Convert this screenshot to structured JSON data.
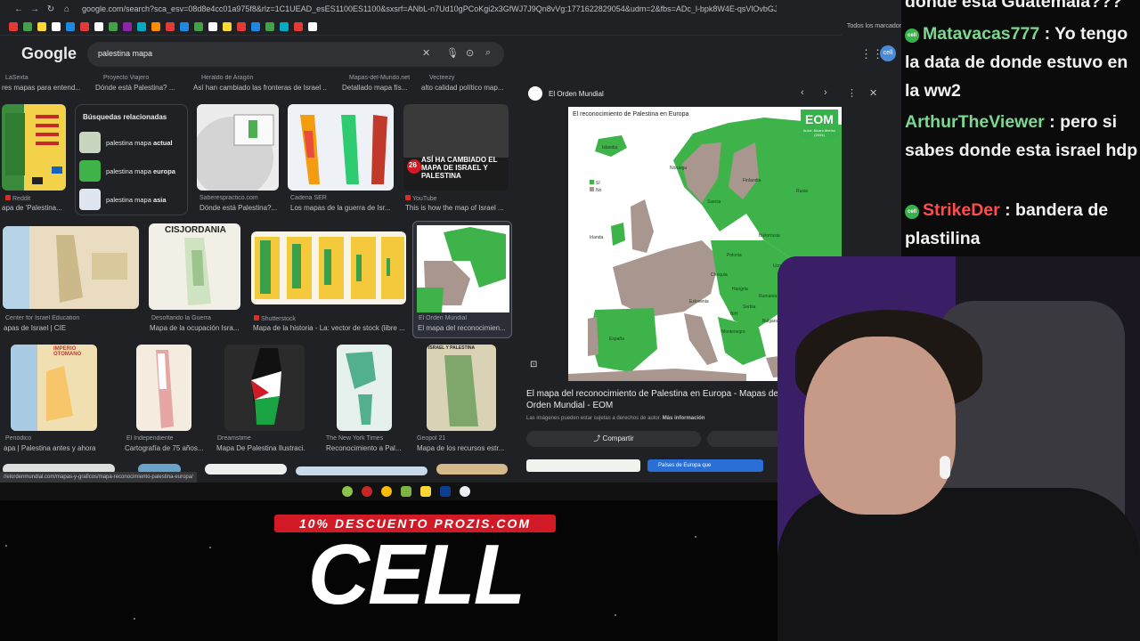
{
  "browser": {
    "url": "google.com/search?sca_esv=08d8e4cc01a975f8&rlz=1C1UEAD_esES1100ES1100&sxsrf=ANbL-n7Ud10gPCoKgi2x3GfWJ7J9Qn8vVg:1771622829054&udm=2&fbs=ADc_l-bpk8W4E-qsVlOvbGJcDwpn60DczFdcvPnuv8WQchHL",
    "bookmarks_all": "Todos los marcador",
    "status_url": "//elordenmundial.com/mapas-y-graficos/mapa-reconocimiento-palestina-europa/"
  },
  "google": {
    "logo": "Google",
    "query": "palestina mapa"
  },
  "row0_meta": [
    {
      "source": "LaSexta",
      "title": "res mapas para entend..."
    },
    {
      "source": "Proyecto Viajero",
      "title": "Dónde está Palestina? ..."
    },
    {
      "source": "Heraldo de Aragón",
      "title": "Así han cambiado las fronteras de Israel ..."
    },
    {
      "source": "Mapas-del-Mundo.net",
      "title": "Detallado mapa fís..."
    },
    {
      "source": "Vecteezy",
      "title": "alto calidad político map..."
    }
  ],
  "related": {
    "title": "Búsquedas relacionadas",
    "items": [
      {
        "prefix": "palestina mapa ",
        "bold": "actual"
      },
      {
        "prefix": "palestina mapa ",
        "bold": "europa"
      },
      {
        "prefix": "palestina mapa ",
        "bold": "asia"
      }
    ]
  },
  "row1": [
    {
      "source": "Reddit",
      "title": "apa de 'Palestina..."
    },
    {
      "source": "Saberespractico.com",
      "title": "Dónde está Palestina?..."
    },
    {
      "source": "Cadena SER",
      "title": "Los mapas de la guerra de Isr..."
    },
    {
      "source": "YouTube",
      "title": "This is how the map of Israel ..."
    }
  ],
  "row1_overlay": {
    "number": "26",
    "text": "ASÍ HA CAMBIADO EL MAPA DE ISRAEL Y PALESTINA"
  },
  "row2": [
    {
      "source": "Center for Israel Education",
      "title": "apas de Israel | CIE"
    },
    {
      "source": "Desoftando la Guerra",
      "title": "Mapa de la ocupación Isra..."
    },
    {
      "source": "Shutterstock",
      "title": "Mapa de la historia - La: vector de stock (libre ..."
    },
    {
      "source": "El Orden Mundial",
      "title": "El mapa del reconocimien..."
    }
  ],
  "row2_label": "CISJORDANIA",
  "row3": [
    {
      "source": "Periódico",
      "title": "apa | Palestina antes y ahora"
    },
    {
      "source": "El Independiente",
      "title": "Cartografía de 75 años..."
    },
    {
      "source": "Dreamstime",
      "title": "Mapa De Palestina Ilustraci..."
    },
    {
      "source": "The New York Times",
      "title": "Reconocimiento a Pal..."
    },
    {
      "source": "Geopol 21",
      "title": "Mapa de los recursos estr..."
    }
  ],
  "row3_labels": {
    "imperio": "IMPERIO OTOMANO",
    "isafrica": "ISRAEL Y PALESTINA"
  },
  "panel": {
    "source": "El Orden Mundial",
    "map_title": "El reconocimiento de Palestina en Europa",
    "logo": "EOM",
    "logo_sub": "Autor: Álvaro Merino (2024)",
    "legend": [
      {
        "label": "Sí",
        "color": "#3db34a"
      },
      {
        "label": "No",
        "color": "#a8968f"
      }
    ],
    "map_labels": [
      "Islandia",
      "Noruega",
      "Suecia",
      "Finlandia",
      "Rusia",
      "Irlanda",
      "Polonia",
      "Bielorrusia",
      "Ucrania",
      "Chequia",
      "Hungría",
      "Rumanía",
      "Eslovenia",
      "BiH",
      "Serbia",
      "Bulgaria",
      "España",
      "Montenegro"
    ],
    "caption": "El mapa del reconocimiento de Palestina en Europa - Mapas de El Orden Mundial - EOM",
    "note": "Las imágenes pueden estar sujetas a derechos de autor.",
    "note_link": "Más información",
    "share": "Compartir",
    "strip_label": "Países de Europa que"
  },
  "chat": [
    {
      "user": "",
      "text": "donde esta Guatemala???",
      "color": "#f2f2f2"
    },
    {
      "user": "Matavacas777",
      "text": " : Yo tengo la data de donde estuvo en la ww2",
      "color": "#7bd88f"
    },
    {
      "user": "ArthurTheViewer",
      "text": " : pero si sabes donde esta israel hdp",
      "color": "#7bd88f"
    },
    {
      "user": "StrikeDer",
      "text": " : bandera de plastilina",
      "color": "#ff4d4d"
    }
  ],
  "badge": "cell",
  "sponsor": {
    "banner": "10% DESCUENTO PROZIS.COM",
    "code": "CELL"
  }
}
